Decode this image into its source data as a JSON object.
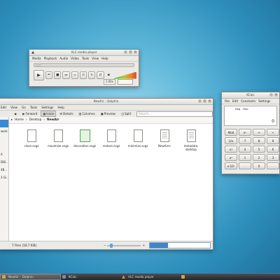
{
  "vlc": {
    "title": "VLC media player",
    "menu": [
      "Media",
      "Playback",
      "Audio",
      "Video",
      "Tools",
      "View",
      "Help"
    ],
    "controls": [
      "play-icon",
      "prev-icon",
      "stop-icon",
      "next-icon",
      "fullscreen-icon",
      "playlist-icon",
      "loop-icon",
      "shuffle-icon",
      "volume-icon"
    ],
    "speed": "1.00x"
  },
  "dolphin": {
    "title": "NewAir – Dolphin",
    "menu": [
      "Edit",
      "View",
      "Go",
      "Tools",
      "Settings",
      "Help"
    ],
    "toolbar": {
      "back": "",
      "forward": "Forward",
      "icons": "Icons",
      "details": "Details",
      "columns": "Columns",
      "preview": "Preview",
      "split": "Split"
    },
    "search_placeholder": "Search...",
    "breadcrumb": [
      "Home",
      "Desktop",
      "NewAir"
    ],
    "places": [
      "",
      "work",
      "",
      "",
      "A",
      "DiB...",
      "4B...",
      "3 Gi..."
    ],
    "files": [
      {
        "name": "close.svgz",
        "icon": "file-icon"
      },
      {
        "name": "maximize.svgz",
        "icon": "file-icon"
      },
      {
        "name": "decoration.svgz",
        "icon": "file-icon"
      },
      {
        "name": "restore.svgz",
        "icon": "file-icon"
      },
      {
        "name": "minimize.svgz",
        "icon": "file-icon"
      },
      {
        "name": "NewAirrc",
        "icon": "text-file-icon"
      },
      {
        "name": "metadata.\ndesktop",
        "icon": "text-file-icon"
      }
    ],
    "status": "7 Files (18.7 KiB)",
    "free_space": "32.1 GiB free",
    "disk_used_fraction": 0.3
  },
  "kcalc": {
    "title": "KCalc",
    "menu": [
      "File",
      "Edit",
      "Constants",
      "Settings"
    ],
    "mode": [
      "Deg",
      "Dep"
    ],
    "display_value": "0",
    "buttons": [
      "Mod",
      "x²",
      "+",
      "÷",
      "1/x",
      "7",
      "8",
      "9",
      "x!",
      "4",
      "5",
      "6",
      "x²",
      "1",
      "2",
      "3",
      "x·10ʸ",
      "",
      "0",
      ""
    ]
  },
  "taskbar": {
    "items": [
      "NewAir – Dolphin",
      "KCalc",
      "VLC media player",
      ""
    ]
  },
  "colors": {
    "accent": "#3a8ad6",
    "desktop": "#2e8fbc"
  }
}
